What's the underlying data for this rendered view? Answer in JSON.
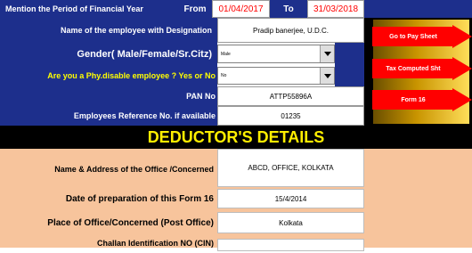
{
  "header": {
    "period_label": "Mention the Period of Financial Year",
    "from_label": "From",
    "from_value": "01/04/2017",
    "to_label": "To",
    "to_value": "31/03/2018"
  },
  "employee": {
    "name_label": "Name of the employee with Designation",
    "name_value": "Pradip banerjee, U.D.C.",
    "gender_label": "Gender( Male/Female/Sr.Citz)",
    "gender_value": "Male",
    "disable_label": "Are you a Phy.disable employee ? Yes or No",
    "disable_value": "No",
    "pan_label": "PAN No",
    "pan_value": "ATTP55896A",
    "ref_label": "Employees Reference No. if available",
    "ref_value": "01235"
  },
  "nav": {
    "pay_sheet": "Go to Pay Sheet",
    "tax_computed": "Tax Computed Sht",
    "form16": "Form 16"
  },
  "deductor": {
    "title": "DEDUCTOR'S DETAILS",
    "office_label": "Name  & Address of the Office /Concerned",
    "office_value": "ABCD, OFFICE, KOLKATA",
    "date_label": "Date of preparation of this Form 16",
    "date_value": "15/4/2014",
    "place_label": "Place of Office/Concerned (Post Office)",
    "place_value": "Kolkata",
    "challan_label": "Challan Identification NO (CIN)"
  },
  "colors": {
    "navy": "#1d2f8c",
    "yellow_text": "#ffff00",
    "red_text": "#ff0000",
    "deductor_title": "#ffee00",
    "salmon": "#f7c49c",
    "nav_button": "#ff0000"
  }
}
